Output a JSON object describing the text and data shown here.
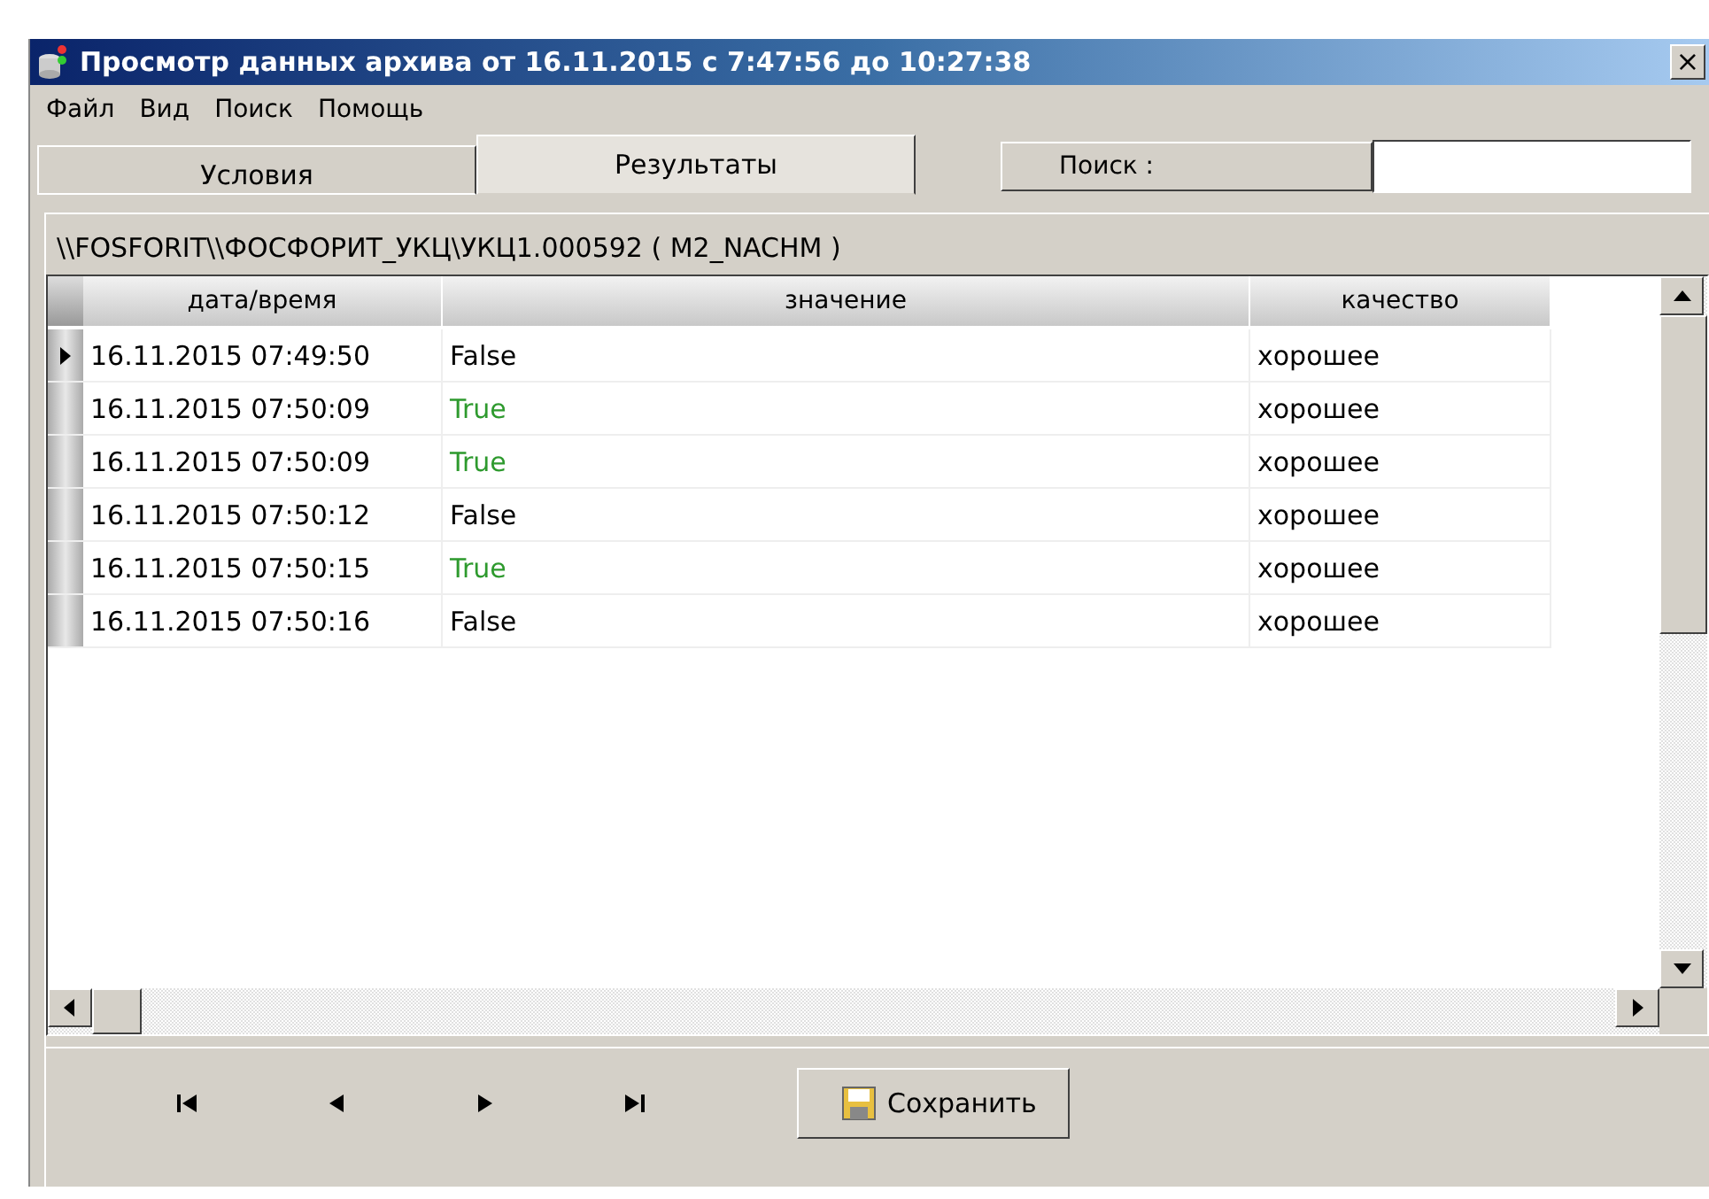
{
  "window": {
    "title": "Просмотр данных архива от 16.11.2015 с 7:47:56 до 10:27:38",
    "close": "×"
  },
  "menu": [
    "Файл",
    "Вид",
    "Поиск",
    "Помощь"
  ],
  "tabs": [
    {
      "label": "Условия",
      "selected": false
    },
    {
      "label": "Результаты",
      "selected": true
    }
  ],
  "search": {
    "label": "Поиск :"
  },
  "path": "\\\\FOSFORIT\\\\ФОСФОРИТ_УКЦ\\УКЦ1.000592 ( M2_NACHM )",
  "table": {
    "columns": [
      "дата/время",
      "значение",
      "качество"
    ],
    "rows": [
      {
        "selected": true,
        "datetime": "16.11.2015 07:49:50",
        "value": "False",
        "color": "#000000",
        "quality": "хорошее"
      },
      {
        "selected": false,
        "datetime": "16.11.2015 07:50:09",
        "value": "True",
        "color": "#2e9a2e",
        "quality": "хорошее"
      },
      {
        "selected": false,
        "datetime": "16.11.2015 07:50:09",
        "value": "True",
        "color": "#2e9a2e",
        "quality": "хорошее"
      },
      {
        "selected": false,
        "datetime": "16.11.2015 07:50:12",
        "value": "False",
        "color": "#000000",
        "quality": "хорошее"
      },
      {
        "selected": false,
        "datetime": "16.11.2015 07:50:15",
        "value": "True",
        "color": "#2e9a2e",
        "quality": "хорошее"
      },
      {
        "selected": false,
        "datetime": "16.11.2015 07:50:16",
        "value": "False",
        "color": "#000000",
        "quality": "хорошее"
      }
    ]
  },
  "navigation": [
    {
      "kind": "first"
    },
    {
      "kind": "prev"
    },
    {
      "kind": "next"
    },
    {
      "kind": "last"
    }
  ],
  "save_button": "Сохранить"
}
